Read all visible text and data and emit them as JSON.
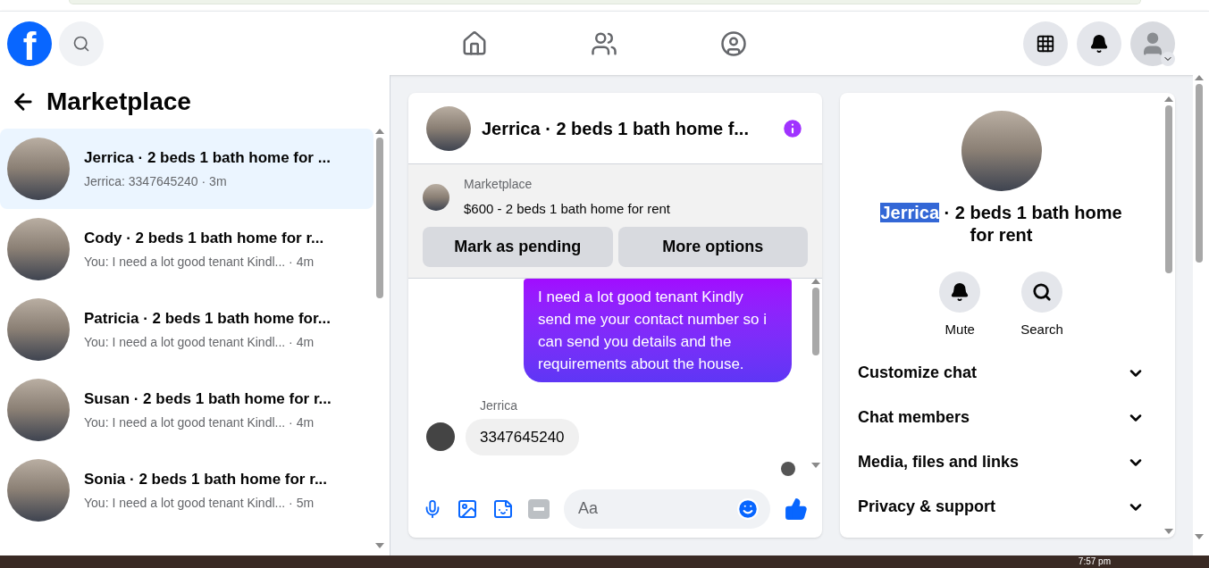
{
  "top_nav": {
    "logo": "f",
    "tabs": [
      {
        "kind": "home",
        "selected": false
      },
      {
        "kind": "friends",
        "selected": false
      },
      {
        "kind": "groups",
        "selected": false
      }
    ]
  },
  "sidebar": {
    "title": "Marketplace",
    "conversations": [
      {
        "name": "Jerrica · 2 beds 1 bath home for ...",
        "preview": "Jerrica: 3347645240 · 3m",
        "selected": true
      },
      {
        "name": "Cody · 2 beds 1 bath home for r...",
        "preview": "You: I need a lot good tenant Kindl... · 4m",
        "selected": false
      },
      {
        "name": "Patricia · 2 beds 1 bath home for...",
        "preview": "You: I need a lot good tenant Kindl... · 4m",
        "selected": false
      },
      {
        "name": "Susan · 2 beds 1 bath home for r...",
        "preview": "You: I need a lot good tenant Kindl... · 4m",
        "selected": false
      },
      {
        "name": "Sonia · 2 beds 1 bath home for r...",
        "preview": "You: I need a lot good tenant Kindl... · 5m",
        "selected": false
      }
    ]
  },
  "chat": {
    "title": "Jerrica · 2 beds 1 bath home f...",
    "listing": {
      "source": "Marketplace",
      "title": "$600 - 2 beds 1 bath home for rent"
    },
    "buttons": [
      "Mark as pending",
      "More options"
    ],
    "messages": [
      {
        "kind": "sent",
        "text": "I need a lot good tenant Kindly send me your contact number so i can send you details and the requirements about the house."
      },
      {
        "kind": "received",
        "sender": "Jerrica",
        "text": "3347645240"
      }
    ],
    "composer": {
      "placeholder": "Aa"
    }
  },
  "details": {
    "title_selected": "Jerrica",
    "title_rest": " · 2 beds 1 bath home for rent",
    "actions": [
      {
        "kind": "mute",
        "label": "Mute"
      },
      {
        "kind": "search",
        "label": "Search"
      }
    ],
    "sections": [
      {
        "label": "Customize chat",
        "expanded": false
      },
      {
        "label": "Chat members",
        "expanded": false
      },
      {
        "label": "Media, files and links",
        "expanded": false
      },
      {
        "label": "Privacy & support",
        "expanded": false
      }
    ]
  },
  "taskbar": {
    "clock": "7:57 pm"
  }
}
